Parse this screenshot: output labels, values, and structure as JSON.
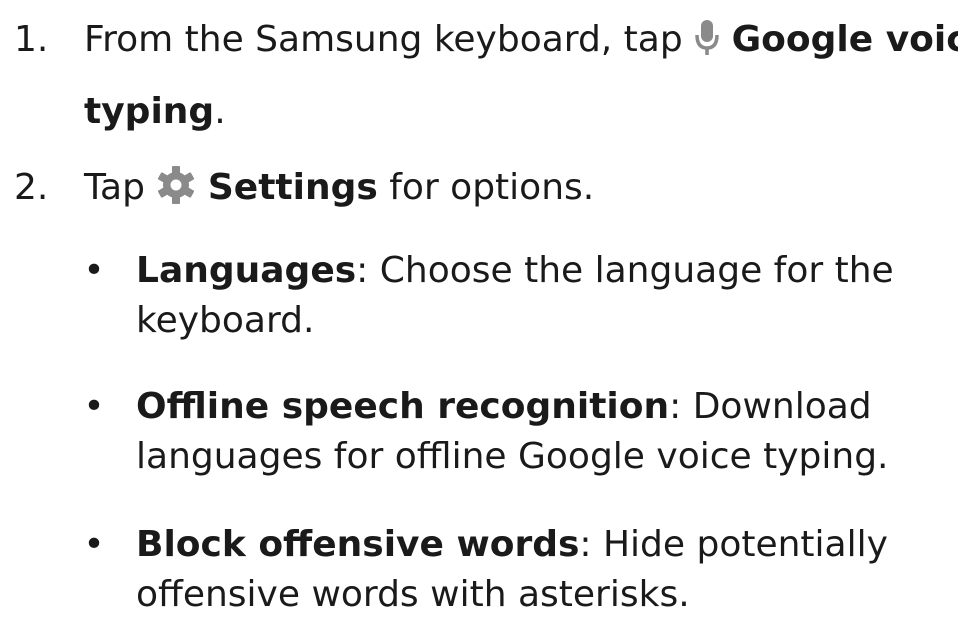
{
  "steps": [
    {
      "number": "1.",
      "pre": "From the Samsung keyboard, tap",
      "icon": "microphone-icon",
      "bold": "Google voice",
      "bold2": "typing",
      "post": "."
    },
    {
      "number": "2.",
      "pre": "Tap",
      "icon": "gear-icon",
      "bold": "Settings",
      "post": " for options."
    }
  ],
  "options": [
    {
      "term": "Languages",
      "line1": ": Choose the language for the",
      "line2": "keyboard."
    },
    {
      "term": "Offline speech recognition",
      "line1": ": Download",
      "line2": "languages for offline Google voice typing."
    },
    {
      "term": "Block offensive words",
      "line1": ": Hide potentially",
      "line2": "offensive words with asterisks."
    }
  ],
  "bullet_glyph": "•",
  "colors": {
    "text": "#1a1a1a",
    "icon": "#8a8a8a"
  }
}
